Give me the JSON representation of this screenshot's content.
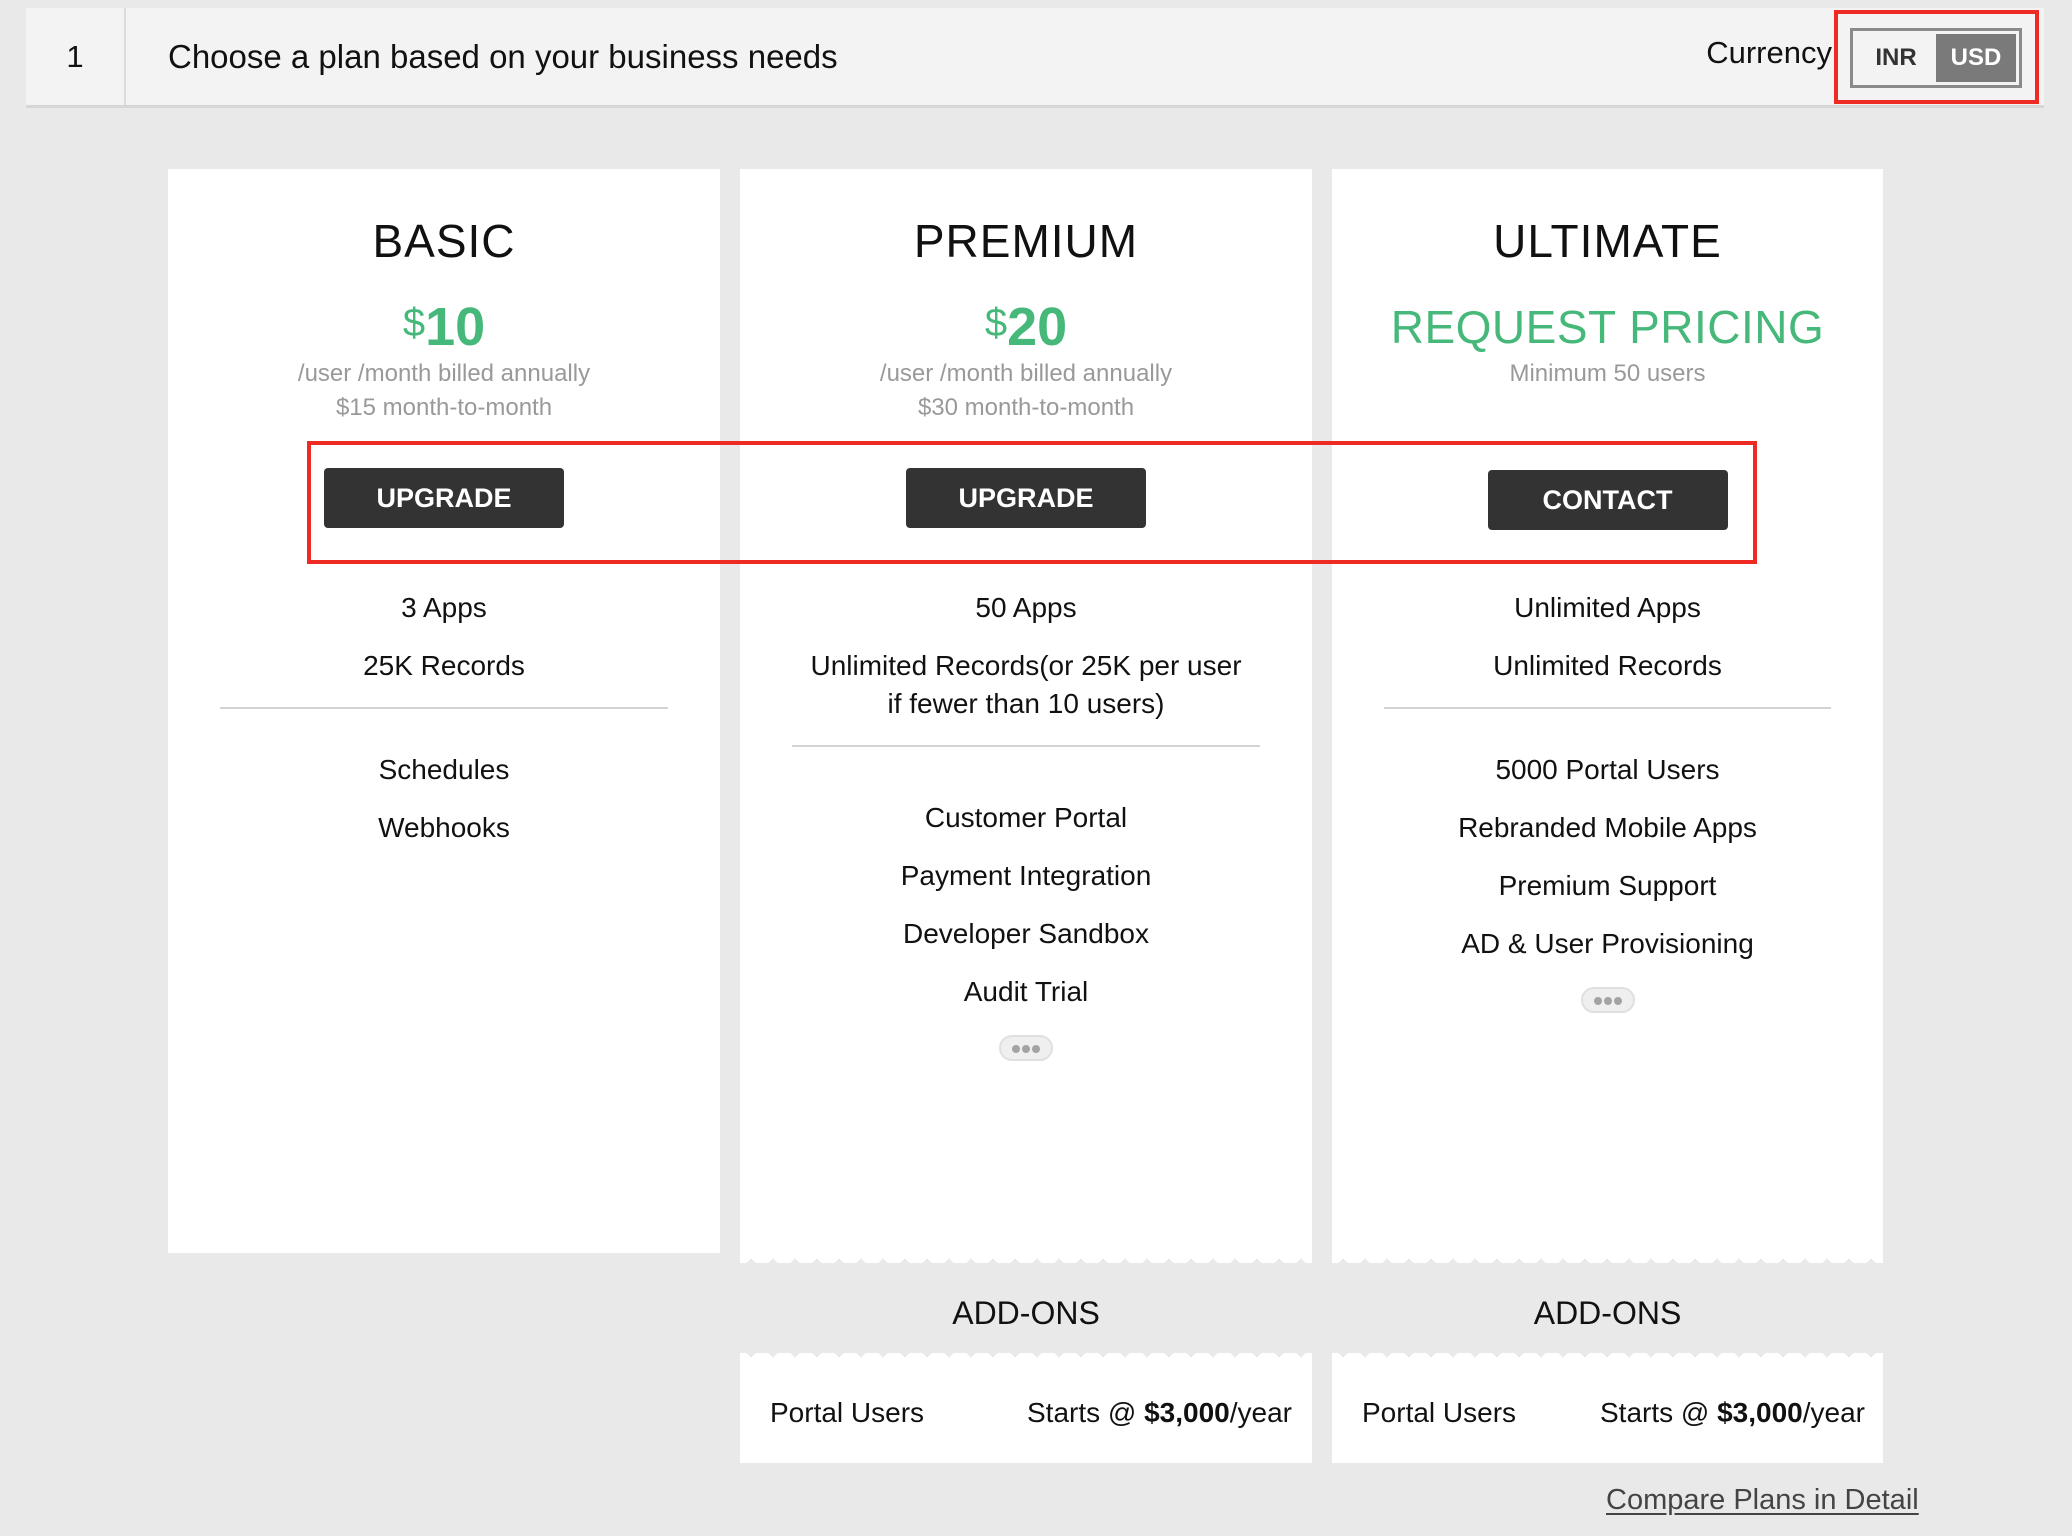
{
  "header": {
    "step_number": "1",
    "title": "Choose a plan based on your business needs",
    "currency_label": "Currency",
    "currency_options": [
      "INR",
      "USD"
    ],
    "currency_selected": "USD"
  },
  "plans": [
    {
      "name": "BASIC",
      "price_currency": "$",
      "price_amount": "10",
      "price_sub": [
        "/user /month billed annually",
        "$15 month-to-month"
      ],
      "button_label": "UPGRADE",
      "limits": [
        "3 Apps",
        "25K Records"
      ],
      "features": [
        "Schedules",
        "Webhooks"
      ],
      "has_more": false
    },
    {
      "name": "PREMIUM",
      "price_currency": "$",
      "price_amount": "20",
      "price_sub": [
        "/user /month billed annually",
        "$30 month-to-month"
      ],
      "button_label": "UPGRADE",
      "limits": [
        "50 Apps",
        "Unlimited Records(or 25K per user if fewer than 10 users)"
      ],
      "features": [
        "Customer Portal",
        "Payment Integration",
        "Developer Sandbox",
        "Audit Trial"
      ],
      "has_more": true,
      "addons_title": "ADD-ONS",
      "addons": [
        {
          "name": "Portal Users",
          "price_prefix": "Starts @ ",
          "price_value": "$3,000",
          "price_suffix": "/year"
        }
      ]
    },
    {
      "name": "ULTIMATE",
      "price_text": "REQUEST PRICING",
      "price_sub": [
        "Minimum 50 users"
      ],
      "button_label": "CONTACT",
      "limits": [
        "Unlimited Apps",
        "Unlimited Records"
      ],
      "features": [
        "5000 Portal Users",
        "Rebranded Mobile Apps",
        "Premium Support",
        "AD & User Provisioning"
      ],
      "has_more": true,
      "addons_title": "ADD-ONS",
      "addons": [
        {
          "name": "Portal Users",
          "price_prefix": "Starts @ ",
          "price_value": "$3,000",
          "price_suffix": "/year"
        }
      ]
    }
  ],
  "compare_link": "Compare Plans in Detail",
  "colors": {
    "accent_green": "#46b87a",
    "button_dark": "#333333",
    "highlight_red": "#ee2a24",
    "toggle_active": "#7a7a7a"
  }
}
